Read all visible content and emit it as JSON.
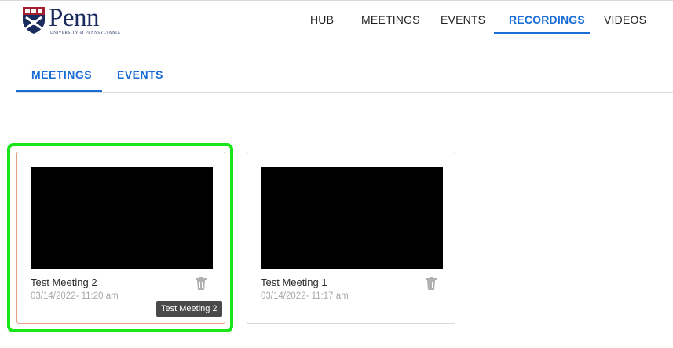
{
  "brand": {
    "name": "Penn",
    "subtitle": "UNIVERSITY of PENNSYLVANIA",
    "color": "#1a2b5e",
    "shield_color": "#a31f34"
  },
  "nav": {
    "items": [
      {
        "label": "HUB",
        "active": false
      },
      {
        "label": "MEETINGS",
        "active": false
      },
      {
        "label": "EVENTS",
        "active": false
      },
      {
        "label": "RECORDINGS",
        "active": true
      },
      {
        "label": "VIDEOS",
        "active": false
      }
    ],
    "accent_color": "#1a6dd6"
  },
  "subtabs": {
    "items": [
      {
        "label": "MEETINGS",
        "active": true
      },
      {
        "label": "EVENTS",
        "active": false
      }
    ]
  },
  "recordings": [
    {
      "title": "Test Meeting 2",
      "datetime": "03/14/2022- 11:20 am",
      "selected": true,
      "icon": "trash-icon"
    },
    {
      "title": "Test Meeting 1",
      "datetime": "03/14/2022- 11:17 am",
      "selected": false,
      "icon": "trash-icon"
    }
  ],
  "tooltip": {
    "text": "Test Meeting 2"
  },
  "highlight_color": "#19e619"
}
